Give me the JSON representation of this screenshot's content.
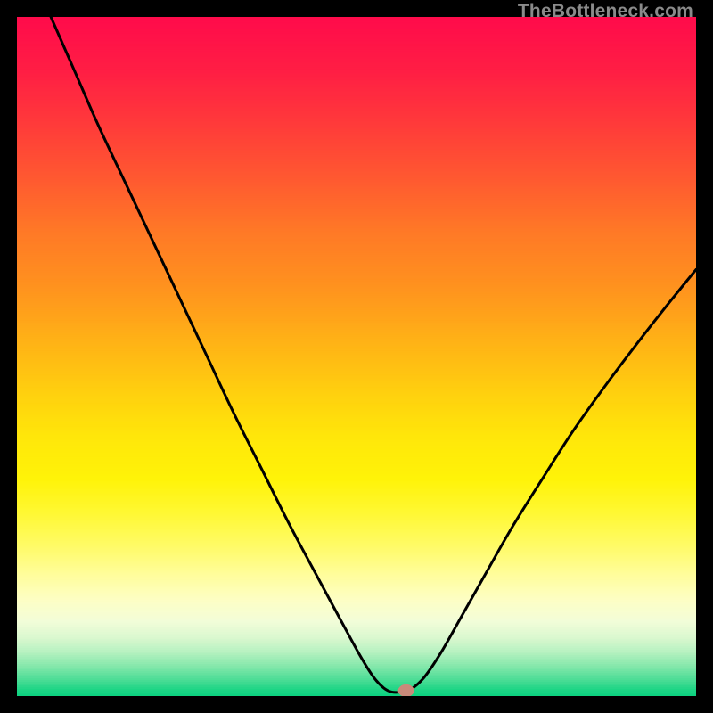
{
  "watermark": "TheBottleneck.com",
  "colors": {
    "curve": "#000000",
    "marker": "#c98a7a",
    "frame": "#000000"
  },
  "chart_data": {
    "type": "line",
    "title": "",
    "xlabel": "",
    "ylabel": "",
    "xlim": [
      0,
      1
    ],
    "ylim": [
      0,
      1
    ],
    "gradient_stops": [
      {
        "y_frac": 0.0,
        "color": "#ff0b4b"
      },
      {
        "y_frac": 0.08,
        "color": "#ff1e44"
      },
      {
        "y_frac": 0.16,
        "color": "#ff3b3a"
      },
      {
        "y_frac": 0.24,
        "color": "#ff5a30"
      },
      {
        "y_frac": 0.32,
        "color": "#ff7a26"
      },
      {
        "y_frac": 0.4,
        "color": "#ff931e"
      },
      {
        "y_frac": 0.48,
        "color": "#ffb316"
      },
      {
        "y_frac": 0.56,
        "color": "#ffd20e"
      },
      {
        "y_frac": 0.62,
        "color": "#ffe70a"
      },
      {
        "y_frac": 0.68,
        "color": "#fff308"
      },
      {
        "y_frac": 0.73,
        "color": "#fff833"
      },
      {
        "y_frac": 0.78,
        "color": "#fffb68"
      },
      {
        "y_frac": 0.82,
        "color": "#fffd9a"
      },
      {
        "y_frac": 0.86,
        "color": "#fdfec6"
      },
      {
        "y_frac": 0.89,
        "color": "#f2fdd8"
      },
      {
        "y_frac": 0.915,
        "color": "#d9f8cf"
      },
      {
        "y_frac": 0.935,
        "color": "#b6f1c0"
      },
      {
        "y_frac": 0.955,
        "color": "#87e8ac"
      },
      {
        "y_frac": 0.975,
        "color": "#4fdd97"
      },
      {
        "y_frac": 0.99,
        "color": "#1fd586"
      },
      {
        "y_frac": 1.0,
        "color": "#0bd17f"
      }
    ],
    "curve_points": [
      {
        "x": 0.05,
        "y": 1.0
      },
      {
        "x": 0.085,
        "y": 0.92
      },
      {
        "x": 0.12,
        "y": 0.84
      },
      {
        "x": 0.16,
        "y": 0.755
      },
      {
        "x": 0.2,
        "y": 0.67
      },
      {
        "x": 0.24,
        "y": 0.585
      },
      {
        "x": 0.28,
        "y": 0.5
      },
      {
        "x": 0.32,
        "y": 0.415
      },
      {
        "x": 0.36,
        "y": 0.335
      },
      {
        "x": 0.4,
        "y": 0.255
      },
      {
        "x": 0.44,
        "y": 0.18
      },
      {
        "x": 0.475,
        "y": 0.115
      },
      {
        "x": 0.505,
        "y": 0.06
      },
      {
        "x": 0.525,
        "y": 0.028
      },
      {
        "x": 0.54,
        "y": 0.012
      },
      {
        "x": 0.552,
        "y": 0.006
      },
      {
        "x": 0.565,
        "y": 0.006
      },
      {
        "x": 0.58,
        "y": 0.01
      },
      {
        "x": 0.6,
        "y": 0.028
      },
      {
        "x": 0.625,
        "y": 0.065
      },
      {
        "x": 0.655,
        "y": 0.118
      },
      {
        "x": 0.69,
        "y": 0.18
      },
      {
        "x": 0.73,
        "y": 0.25
      },
      {
        "x": 0.775,
        "y": 0.322
      },
      {
        "x": 0.82,
        "y": 0.392
      },
      {
        "x": 0.87,
        "y": 0.462
      },
      {
        "x": 0.92,
        "y": 0.528
      },
      {
        "x": 0.965,
        "y": 0.585
      },
      {
        "x": 1.0,
        "y": 0.628
      }
    ],
    "marker": {
      "x": 0.573,
      "y": 0.008
    }
  }
}
